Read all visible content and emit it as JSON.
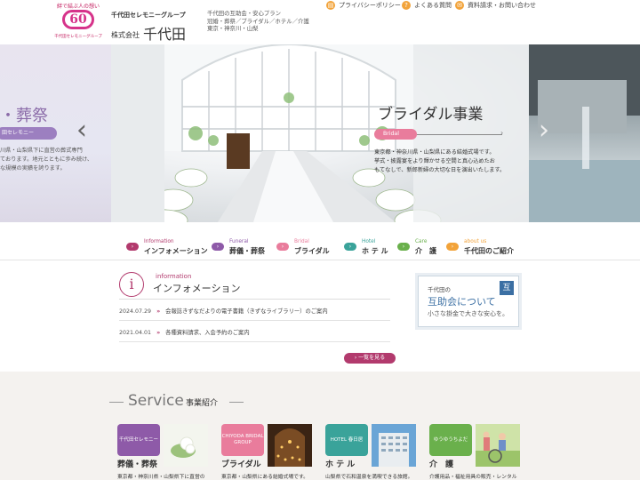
{
  "header": {
    "logo_tagline": "絆で結ぶ人の想い",
    "logo_number": "60",
    "logo_sub": "千代田セレモニーグループ",
    "group_name": "千代田セレモニーグループ",
    "company_prefix": "株式会社",
    "company_name": "千代田",
    "desc_lines": [
      "千代田の互助会・安心プラン",
      "冠婚・葬祭／ブライダル／ホテル／介護",
      "東京・神奈川・山梨"
    ],
    "links": [
      {
        "icon": "document-icon",
        "label": "プライバシーポリシー"
      },
      {
        "icon": "question-icon",
        "label": "よくある質問"
      },
      {
        "icon": "mail-icon",
        "label": "資料請求・お問い合わせ"
      }
    ]
  },
  "hero": {
    "left_title": "・葬祭",
    "left_pill": "田セレモニー",
    "left_desc": [
      "川県・山梨県下に直営の葬式専門",
      "ております。地元とともに歩み続け、",
      "な規模の実績を誇ります。"
    ],
    "title": "ブライダル事業",
    "pill": "Bridal",
    "desc": [
      "東京都・神奈川県・山梨県にある結婚式場です。",
      "挙式・披露宴をより輝かせる空間と真心込めたお",
      "もてなしで、新郎新婦の大切な日を演出いたします。"
    ]
  },
  "nav": [
    {
      "en": "Information",
      "ja": "インフォメーション",
      "color": "#b23a6d"
    },
    {
      "en": "Funeral",
      "ja": "葬儀・葬祭",
      "color": "#8e5aa8"
    },
    {
      "en": "Bridal",
      "ja": "ブライダル",
      "color": "#e97c9c"
    },
    {
      "en": "Hotel",
      "ja": "ホ テ ル",
      "color": "#3aa39a"
    },
    {
      "en": "Care",
      "ja": "介　護",
      "color": "#6ab04c"
    },
    {
      "en": "about us",
      "ja": "千代田のご紹介",
      "color": "#f2a33a"
    }
  ],
  "information": {
    "icon_letter": "i",
    "en": "information",
    "title": "インフォメーション",
    "news": [
      {
        "date": "2024.07.29",
        "text": "会報誌きずなだよりの電子書籍（きずなライブラリー）のご案内"
      },
      {
        "date": "2021.04.01",
        "text": "各種資料請求、入会予約のご案内"
      }
    ],
    "more": "一覧を見る"
  },
  "banner": {
    "line1": "千代田の",
    "line2": "互助会について",
    "line3": "小さな掛金で大きな安心を。",
    "badge": "互"
  },
  "service": {
    "en": "Service",
    "ja": "事業紹介",
    "cards": [
      {
        "logo": "千代田セレモニー",
        "name": "葬儀・葬祭",
        "desc": "東京都・神奈川県・山梨県下に直営の",
        "color": "#8e5aa8"
      },
      {
        "logo": "CHIYODA BRIDAL GROUP",
        "name": "ブライダル",
        "desc": "東京都・山梨県にある結婚式場です。",
        "color": "#e97c9c"
      },
      {
        "logo": "HOTEL 春日居",
        "name": "ホ テ ル",
        "desc": "山梨県で石和温泉を満喫できる旅館。",
        "color": "#3aa39a"
      },
      {
        "logo": "ゆうゆうちよだ",
        "name": "介　護",
        "desc": "介護用品・福祉用具の販売・レンタル",
        "color": "#6ab04c"
      }
    ]
  }
}
